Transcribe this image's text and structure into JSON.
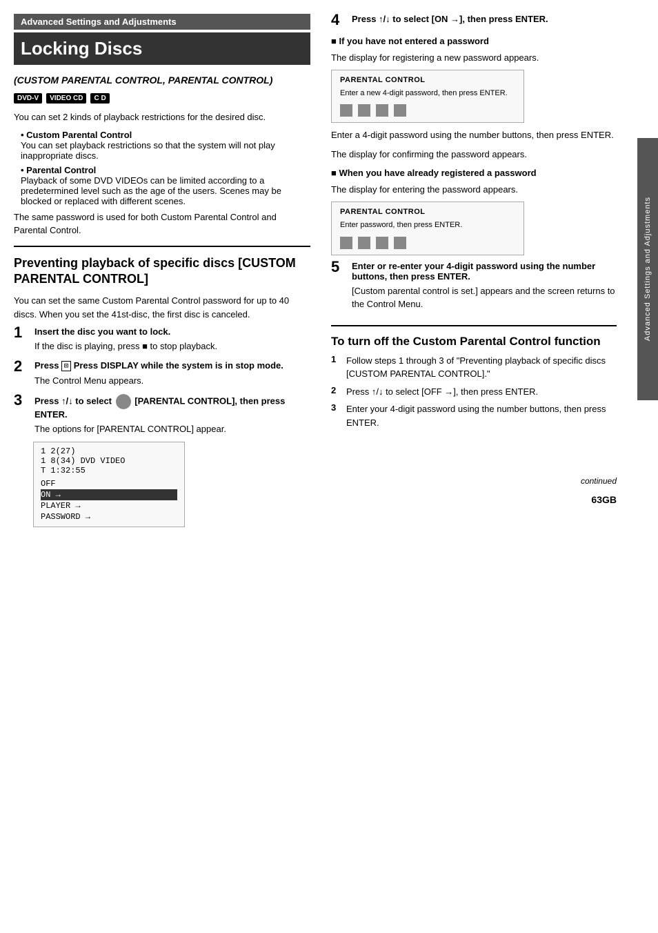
{
  "header": {
    "section": "Advanced Settings and Adjustments",
    "title": "Locking Discs",
    "subtitle": "(CUSTOM PARENTAL CONTROL, PARENTAL CONTROL)"
  },
  "badges": [
    "DVD-V",
    "VIDEO CD",
    "C D"
  ],
  "intro": {
    "para1": "You can set 2 kinds of playback restrictions for the desired disc.",
    "bullet1_title": "Custom Parental Control",
    "bullet1_desc": "You can set playback restrictions so that the system will not play inappropriate discs.",
    "bullet2_title": "Parental Control",
    "bullet2_desc": "Playback of some DVD VIDEOs can be limited according to a predetermined level such as the age of the users. Scenes may be blocked or replaced with different scenes.",
    "para2": "The same password is used for both Custom Parental Control and Parental Control."
  },
  "prevent_section": {
    "title": "Preventing playback of specific discs [CUSTOM PARENTAL CONTROL]",
    "intro": "You can set the same Custom Parental Control password for up to 40 discs. When you set the 41st-disc, the first disc is canceled.",
    "step1_title": "Insert the disc you want to lock.",
    "step1_desc": "If the disc is playing, press ■ to stop playback.",
    "step2_title": "Press  DISPLAY while the system is in stop mode.",
    "step2_desc": "The Control Menu appears.",
    "step3_title": "[PARENTAL CONTROL], then press ENTER.",
    "step3_prefix": "Press ↑/↓ to select",
    "step3_desc": "The options for [PARENTAL CONTROL] appear.",
    "menu": {
      "line1": "1 2(27)",
      "line2": "1 8(34)     DVD VIDEO",
      "line3": "T  1:32:55",
      "items": [
        "OFF",
        "ON →",
        "PLAYER →",
        "PASSWORD →"
      ],
      "selected": "ON →"
    }
  },
  "right_col": {
    "step4_title": "Press ↑/↓ to select [ON →], then press ENTER.",
    "not_entered_title": "■ If you have not entered a password",
    "not_entered_desc": "The display for registering a new password appears.",
    "parental_box1": {
      "title": "PARENTAL CONTROL",
      "text": "Enter a new 4-digit password, then press ENTER.",
      "squares": 4
    },
    "after_box1": "Enter a 4-digit password using the number buttons, then press ENTER.",
    "after_box1b": "The display for confirming the password appears.",
    "registered_title": "■ When you have already registered a password",
    "registered_desc": "The display for entering the password appears.",
    "parental_box2": {
      "title": "PARENTAL CONTROL",
      "text": "Enter password, then press ENTER.",
      "squares": 4
    },
    "step5_title": "Enter or re-enter your 4-digit password using the number buttons, then press ENTER.",
    "step5_desc": "[Custom parental control is set.] appears and the screen returns to the Control Menu.",
    "turnoff_title": "To turn off the Custom Parental Control function",
    "turnoff1": "Follow steps 1 through 3 of \"Preventing playback of specific discs [CUSTOM PARENTAL CONTROL].\"",
    "turnoff2": "Press ↑/↓ to select [OFF →], then press ENTER.",
    "turnoff3": "Enter your 4-digit password using the number buttons, then press ENTER.",
    "continued": "continued",
    "page_num": "63GB"
  },
  "side_tab": "Advanced Settings and Adjustments"
}
